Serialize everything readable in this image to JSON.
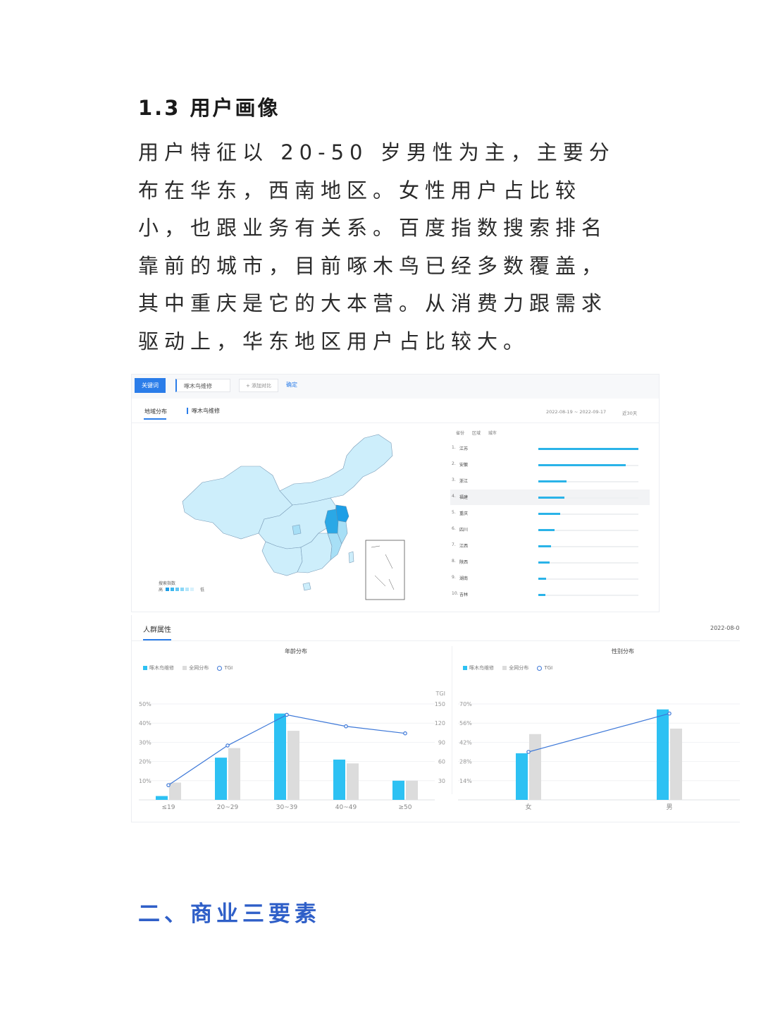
{
  "heading": "1.3 用户画像",
  "paragraph": "用户特征以 20-50 岁男性为主，主要分布在华东，西南地区。女性用户占比较小，也跟业务有关系。百度指数搜索排名靠前的城市，目前啄木鸟已经多数覆盖，其中重庆是它的大本营。从消费力跟需求驱动上，华东地区用户占比较大。",
  "section_heading": "二、商业三要素",
  "search_panel": {
    "keyword_button": "关键词",
    "keyword_input": "啄木鸟维修",
    "add_compare": "+ 添加对比",
    "confirm": "确定",
    "tab_region": "地域分布",
    "series_label": "啄木鸟维修",
    "date_range": "2022-08-19 ~ 2022-09-17",
    "period": "近30天",
    "legend_title": "搜索指数",
    "legend_high": "高",
    "legend_low": "低",
    "legend_colors": [
      "#1d9ee6",
      "#3cb7ef",
      "#63c7f3",
      "#8ad7f7",
      "#b4e6fa",
      "#d7f1fc"
    ],
    "rank_tabs": [
      "省份",
      "区域",
      "城市"
    ],
    "ranking": [
      {
        "rank": "1.",
        "name": "江苏",
        "value": 1.0
      },
      {
        "rank": "2.",
        "name": "安徽",
        "value": 0.87
      },
      {
        "rank": "3.",
        "name": "浙江",
        "value": 0.28
      },
      {
        "rank": "4.",
        "name": "福建",
        "value": 0.26
      },
      {
        "rank": "5.",
        "name": "重庆",
        "value": 0.22
      },
      {
        "rank": "6.",
        "name": "四川",
        "value": 0.16
      },
      {
        "rank": "7.",
        "name": "江西",
        "value": 0.13
      },
      {
        "rank": "8.",
        "name": "陕西",
        "value": 0.11
      },
      {
        "rank": "9.",
        "name": "湖南",
        "value": 0.08
      },
      {
        "rank": "10.",
        "name": "吉林",
        "value": 0.07
      }
    ],
    "highlight_row": 4,
    "map_fill": "#cdeefb",
    "map_stroke": "#7a9cb8",
    "map_highlight": "#2aa8e6",
    "map_mid": "#a7dff6"
  },
  "crowd_panel": {
    "title": "人群属性",
    "date": "2022-08-0",
    "legend": {
      "series": "啄木鸟维修",
      "all": "全网分布",
      "tgi": "TGI"
    },
    "colors": {
      "series": "#2dc1f3",
      "all": "#dcdcdc",
      "tgi": "#3d78d8"
    }
  },
  "chart_data": [
    {
      "type": "bar",
      "title": "年龄分布",
      "categories": [
        "≤19",
        "20~29",
        "30~39",
        "40~49",
        "≥50"
      ],
      "series": [
        {
          "name": "啄木鸟维修",
          "values": [
            2,
            22,
            45,
            21,
            10
          ]
        },
        {
          "name": "全网分布",
          "values": [
            9,
            27,
            36,
            19,
            10
          ]
        },
        {
          "name": "TGI",
          "axis": "right",
          "values": [
            23,
            85,
            133,
            115,
            104
          ]
        }
      ],
      "yticks_left": [
        "50%",
        "40%",
        "30%",
        "20%",
        "10%"
      ],
      "yticks_right": [
        "150",
        "120",
        "90",
        "60",
        "30"
      ],
      "ylim_left": [
        0,
        50
      ],
      "ylim_right": [
        0,
        150
      ],
      "right_axis_label": "TGI"
    },
    {
      "type": "bar",
      "title": "性别分布",
      "categories": [
        "女",
        "男"
      ],
      "series": [
        {
          "name": "啄木鸟维修",
          "values": [
            34,
            66
          ]
        },
        {
          "name": "全网分布",
          "values": [
            48,
            52
          ]
        },
        {
          "name": "TGI",
          "values": [
            35,
            63
          ]
        }
      ],
      "yticks_left": [
        "70%",
        "56%",
        "42%",
        "28%",
        "14%"
      ],
      "ylim_left": [
        0,
        70
      ]
    }
  ]
}
